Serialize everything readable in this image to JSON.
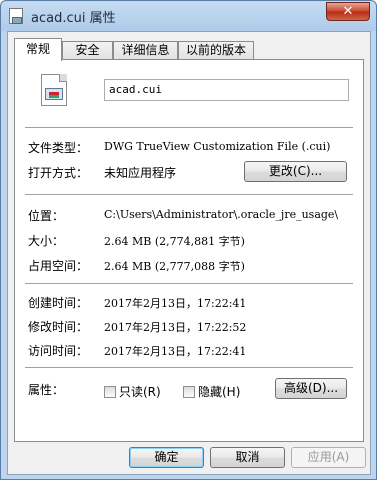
{
  "window": {
    "title": "acad.cui 属性",
    "close_glyph": "✕"
  },
  "tabs": [
    {
      "label": "常规",
      "active": true
    },
    {
      "label": "安全",
      "active": false
    },
    {
      "label": "详细信息",
      "active": false
    },
    {
      "label": "以前的版本",
      "active": false
    }
  ],
  "general": {
    "file_name": "acad.cui",
    "file_type_label": "文件类型：",
    "file_type_value": "DWG TrueView Customization File (.cui)",
    "opens_with_label": "打开方式：",
    "opens_with_value": "未知应用程序",
    "change_button": "更改(C)...",
    "location_label": "位置：",
    "location_value": "C:\\Users\\Administrator\\.oracle_jre_usage\\",
    "size_label": "大小：",
    "size_value": "2.64 MB (2,774,881 字节)",
    "size_on_disk_label": "占用空间：",
    "size_on_disk_value": "2.64 MB (2,777,088 字节)",
    "created_label": "创建时间：",
    "created_value": "2017年2月13日，17:22:41",
    "modified_label": "修改时间：",
    "modified_value": "2017年2月13日，17:22:52",
    "accessed_label": "访问时间：",
    "accessed_value": "2017年2月13日，17:22:41",
    "attributes_label": "属性：",
    "readonly_label": "只读(R)",
    "hidden_label": "隐藏(H)",
    "advanced_button": "高级(D)..."
  },
  "footer": {
    "ok_button": "确定",
    "cancel_button": "取消",
    "apply_button": "应用(A)"
  }
}
